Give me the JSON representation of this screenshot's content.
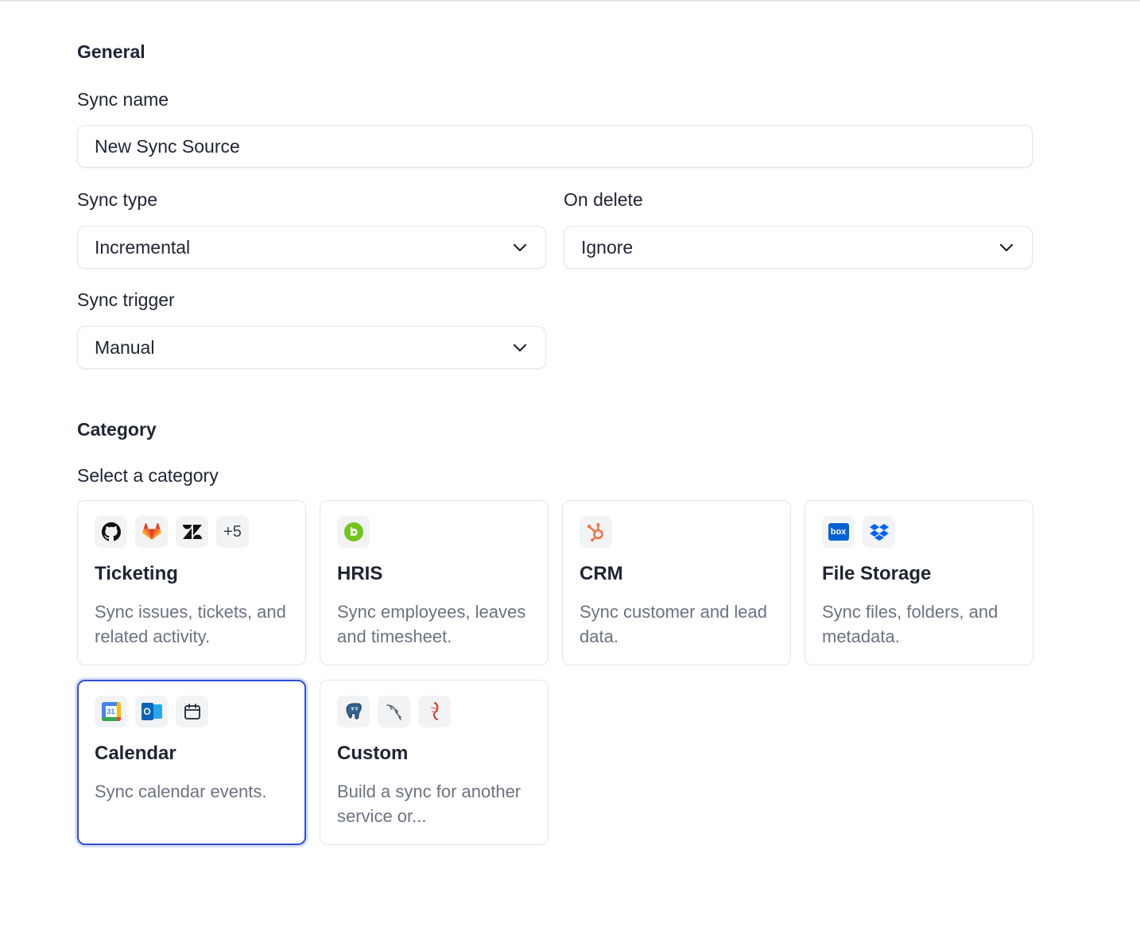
{
  "general": {
    "title": "General",
    "sync_name": {
      "label": "Sync name",
      "value": "New Sync Source"
    },
    "sync_type": {
      "label": "Sync type",
      "value": "Incremental"
    },
    "on_delete": {
      "label": "On delete",
      "value": "Ignore"
    },
    "sync_trigger": {
      "label": "Sync trigger",
      "value": "Manual"
    }
  },
  "category": {
    "title": "Category",
    "subtitle": "Select a category",
    "selected": "Calendar",
    "cards": [
      {
        "title": "Ticketing",
        "description": "Sync issues, tickets, and related activity.",
        "icons": [
          "github-icon",
          "gitlab-icon",
          "zendesk-icon"
        ],
        "more": "+5"
      },
      {
        "title": "HRIS",
        "description": "Sync employees, leaves and timesheet.",
        "icons": [
          "bamboohr-icon"
        ]
      },
      {
        "title": "CRM",
        "description": "Sync customer and lead data.",
        "icons": [
          "hubspot-icon"
        ]
      },
      {
        "title": "File Storage",
        "description": "Sync files, folders, and metadata.",
        "icons": [
          "box-icon",
          "dropbox-icon"
        ],
        "box_text": "box"
      },
      {
        "title": "Calendar",
        "description": "Sync calendar events.",
        "icons": [
          "google-calendar-icon",
          "outlook-icon",
          "calendar-icon"
        ],
        "gcal_text": "31",
        "outlook_text": "O"
      },
      {
        "title": "Custom",
        "description": "Build a sync for another service or...",
        "icons": [
          "postgresql-icon",
          "mysql-icon",
          "redis-icon"
        ]
      }
    ]
  },
  "colors": {
    "selected_border": "#2d4fd6",
    "hubspot": "#f4733e",
    "gitlab": "#e24329",
    "box": "#0061d5",
    "dropbox": "#0061fe",
    "bamboohr": "#73c41d"
  }
}
